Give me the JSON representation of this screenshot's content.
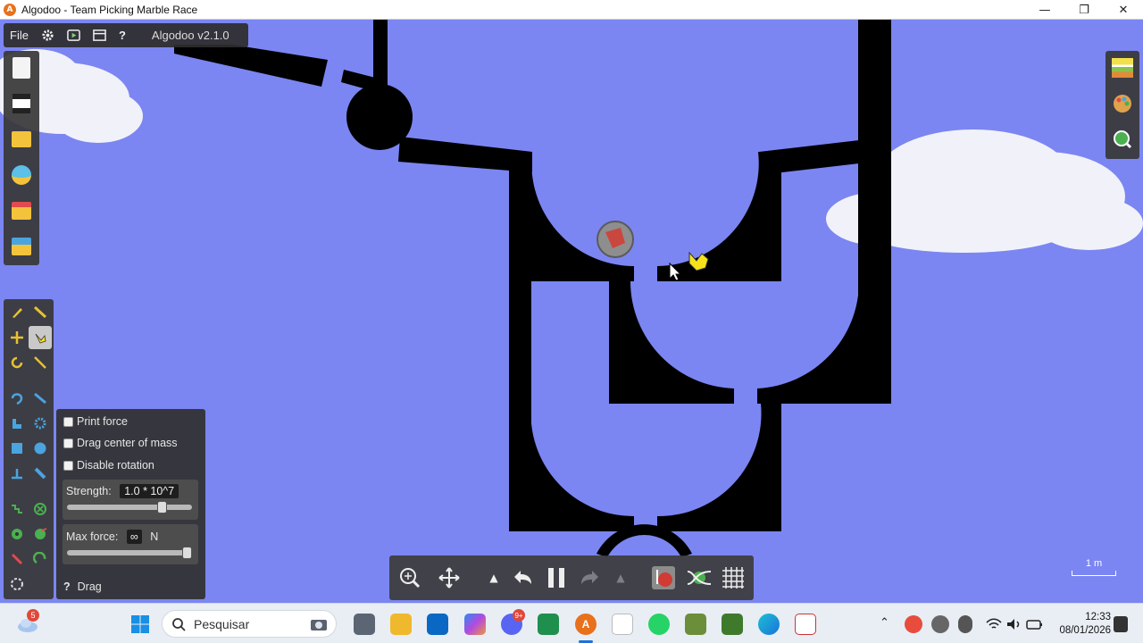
{
  "window": {
    "title": "Algodoo - Team Picking Marble Race",
    "minimize": "—",
    "maximize": "❐",
    "close": "✕"
  },
  "menubar": {
    "file": "File",
    "version": "Algodoo v2.1.0"
  },
  "drag_panel": {
    "print_force": "Print force",
    "drag_center_of_mass": "Drag center of mass",
    "disable_rotation": "Disable rotation",
    "strength_label": "Strength:",
    "strength_value": "1.0 * 10^7",
    "strength_slider_fraction": 0.8,
    "max_force_label": "Max force:",
    "max_force_value": "∞",
    "max_force_unit": "N",
    "max_force_slider_fraction": 1.0,
    "help": "?",
    "tool_name": "Drag"
  },
  "scale_bar": {
    "label": "1 m"
  },
  "taskbar": {
    "search_placeholder": "Pesquisar",
    "weather_badge": "5",
    "discord_badge": "9+",
    "time": "12:33",
    "date": "08/01/2026"
  },
  "colors": {
    "sky": "#7b86f2",
    "track": "#000000",
    "cloud": "#f1f2f9"
  }
}
